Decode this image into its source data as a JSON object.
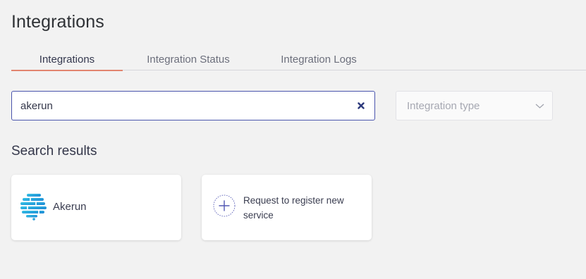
{
  "page": {
    "title": "Integrations"
  },
  "tabs": [
    {
      "label": "Integrations",
      "active": true
    },
    {
      "label": "Integration Status",
      "active": false
    },
    {
      "label": "Integration Logs",
      "active": false
    }
  ],
  "search": {
    "value": "akerun",
    "clear_icon": "close-icon"
  },
  "filter": {
    "placeholder": "Integration type",
    "icon": "chevron-down-icon"
  },
  "results": {
    "title": "Search results",
    "cards": [
      {
        "name": "Akerun",
        "icon": "akerun-logo"
      },
      {
        "label": "Request to register new service",
        "icon": "plus-icon"
      }
    ]
  },
  "colors": {
    "background": "#f2f2f2",
    "tab_active_underline": "#e2846f",
    "search_border": "#4b55ad",
    "brand_gradient_start": "#37c6e6",
    "brand_gradient_end": "#1c84d3"
  }
}
